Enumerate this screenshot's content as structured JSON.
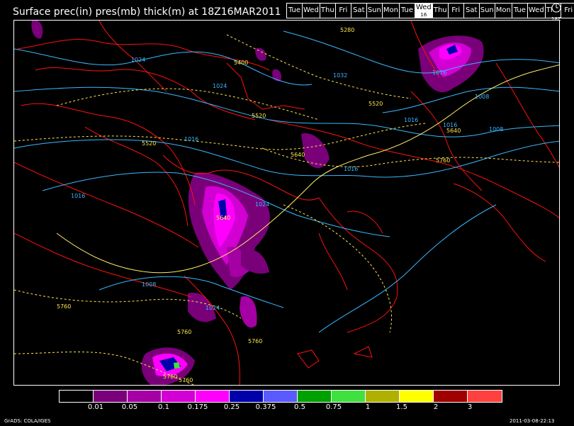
{
  "title": "Surface prec(in) pres(mb) thick(m) at 18Z16MAR2011",
  "days": [
    {
      "label": "Tue",
      "active": false
    },
    {
      "label": "Wed",
      "active": false
    },
    {
      "label": "Thu",
      "active": false
    },
    {
      "label": "Fri",
      "active": false
    },
    {
      "label": "Sat",
      "active": false
    },
    {
      "label": "Sun",
      "active": false
    },
    {
      "label": "Mon",
      "active": false
    },
    {
      "label": "Tue",
      "active": false
    },
    {
      "label": "Wed",
      "sub": "16",
      "active": true
    },
    {
      "label": "Thu",
      "active": false
    },
    {
      "label": "Fri",
      "active": false
    },
    {
      "label": "Sat",
      "active": false
    },
    {
      "label": "Sun",
      "active": false
    },
    {
      "label": "Mon",
      "active": false
    },
    {
      "label": "Tue",
      "active": false
    },
    {
      "label": "Wed",
      "active": false
    },
    {
      "label": "Thu",
      "active": false
    },
    {
      "label": "Fri",
      "active": false
    }
  ],
  "tz_label": "18Z",
  "pressure_labels": [
    "1024",
    "1024",
    "1032",
    "1016",
    "1016",
    "1024",
    "1016",
    "1016",
    "1016",
    "1008",
    "1008",
    "1016",
    "1008",
    "1024"
  ],
  "thickness_labels": [
    "5280",
    "5400",
    "5520",
    "5520",
    "5520",
    "5640",
    "5640",
    "5640",
    "5760",
    "5760",
    "5760",
    "5760",
    "5760",
    "5760"
  ],
  "colorbar": {
    "colors": [
      "#000000",
      "#7a007a",
      "#a400a4",
      "#d200d2",
      "#ff00ff",
      "#0000aa",
      "#5a5aff",
      "#00a000",
      "#40e040",
      "#b0b000",
      "#ffff00",
      "#a00000",
      "#ff4040"
    ],
    "labels": [
      "0.01",
      "0.05",
      "0.1",
      "0.175",
      "0.25",
      "0.375",
      "0.5",
      "0.75",
      "1",
      "1.5",
      "2",
      "3"
    ]
  },
  "credit": "GrADS: COLA/IGES",
  "timestamp": "2011-03-08-22:13"
}
